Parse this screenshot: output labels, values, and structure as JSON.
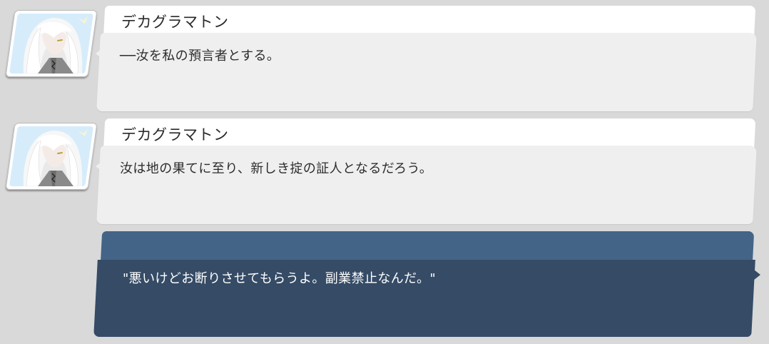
{
  "messages": [
    {
      "speaker": "デカグラマトン",
      "text": "──汝を私の預言者とする。",
      "avatar_icon": "character-portrait-icon"
    },
    {
      "speaker": "デカグラマトン",
      "text": "汝は地の果てに至り、新しき掟の証人となるだろう。",
      "avatar_icon": "character-portrait-icon"
    }
  ],
  "reply": {
    "text": "\"悪いけどお断りさせてもらうよ。副業禁止なんだ。\""
  },
  "colors": {
    "background": "#d9d9d9",
    "name_tab": "#ffffff",
    "bubble": "#efefef",
    "reply_header": "#446487",
    "reply_body": "#354b66"
  }
}
